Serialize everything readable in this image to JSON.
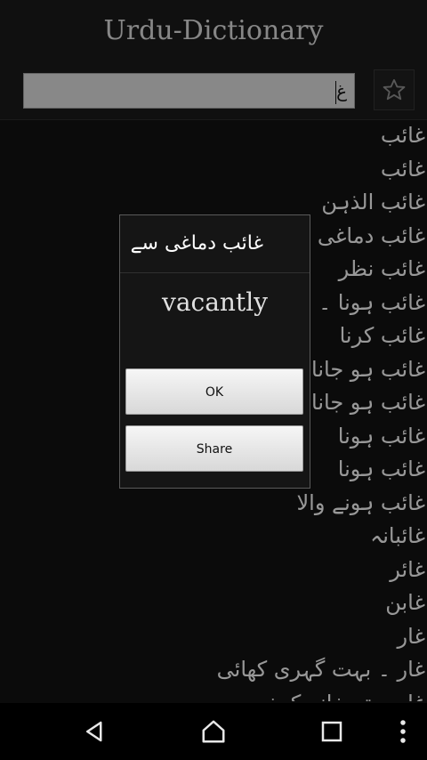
{
  "app": {
    "title": "Urdu-Dictionary"
  },
  "search": {
    "value": "غ"
  },
  "icons": {
    "favorite": "star-outline-icon",
    "back": "back-icon",
    "home": "home-icon",
    "recents": "recents-icon",
    "menu": "overflow-menu-icon"
  },
  "list": {
    "items": [
      "غائب",
      "غائب",
      "غائب الذہن",
      "غائب دماغی سے",
      "غائب نظر",
      "غائب ہونا ۔ نایید",
      "غائب کرنا",
      "غائب ہو جانا",
      "غائب ہو جانا",
      "غائب ہونا",
      "غائب ہونا",
      "غائب ہونے والا",
      "غائبانہ",
      "غائر",
      "غابن",
      "غار",
      "غار ۔ بہت گہری کھائی",
      "غار ۔ تہ خانہ کہف"
    ]
  },
  "dialog": {
    "title": "غائب دماغی سے",
    "translation": "vacantly",
    "ok_label": "OK",
    "share_label": "Share"
  }
}
